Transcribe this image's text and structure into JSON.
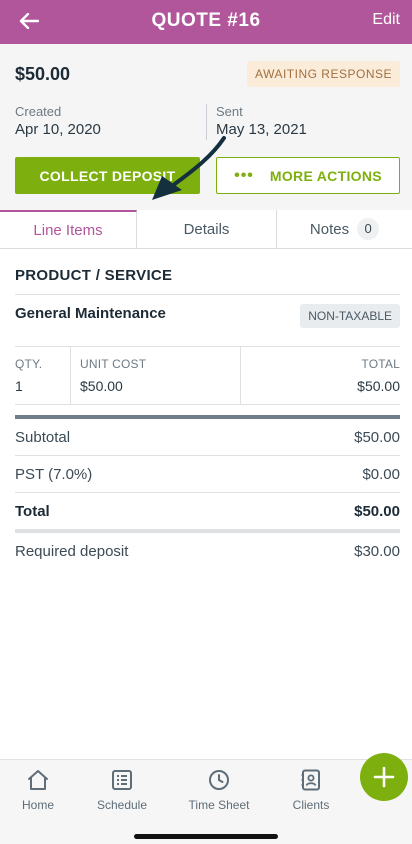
{
  "header": {
    "title": "QUOTE #16",
    "edit_label": "Edit"
  },
  "summary": {
    "amount": "$50.00",
    "status": "AWAITING RESPONSE",
    "created_label": "Created",
    "created_value": "Apr 10, 2020",
    "sent_label": "Sent",
    "sent_value": "May 13, 2021",
    "collect_label": "COLLECT DEPOSIT",
    "more_label": "MORE ACTIONS",
    "more_dots": "•••"
  },
  "tabs": [
    {
      "label": "Line Items"
    },
    {
      "label": "Details"
    },
    {
      "label": "Notes",
      "count": "0"
    }
  ],
  "line_items": {
    "section_title": "PRODUCT / SERVICE",
    "item_name": "General Maintenance",
    "tax_badge": "NON-TAXABLE",
    "qty_header": "QTY.",
    "unit_header": "UNIT COST",
    "total_header": "TOTAL",
    "qty": "1",
    "unit_cost": "$50.00",
    "total": "$50.00"
  },
  "totals": {
    "subtotal_label": "Subtotal",
    "subtotal_value": "$50.00",
    "tax_label": "PST (7.0%)",
    "tax_value": "$0.00",
    "total_label": "Total",
    "total_value": "$50.00",
    "deposit_label": "Required deposit",
    "deposit_value": "$30.00"
  },
  "bottom_nav": [
    {
      "label": "Home",
      "icon": "home-icon"
    },
    {
      "label": "Schedule",
      "icon": "schedule-icon"
    },
    {
      "label": "Time Sheet",
      "icon": "clock-icon"
    },
    {
      "label": "Clients",
      "icon": "contacts-icon"
    }
  ],
  "colors": {
    "brand": "#b2569b",
    "accent": "#7db00e",
    "badge_bg": "#fbecd9",
    "badge_text": "#a2703f"
  }
}
